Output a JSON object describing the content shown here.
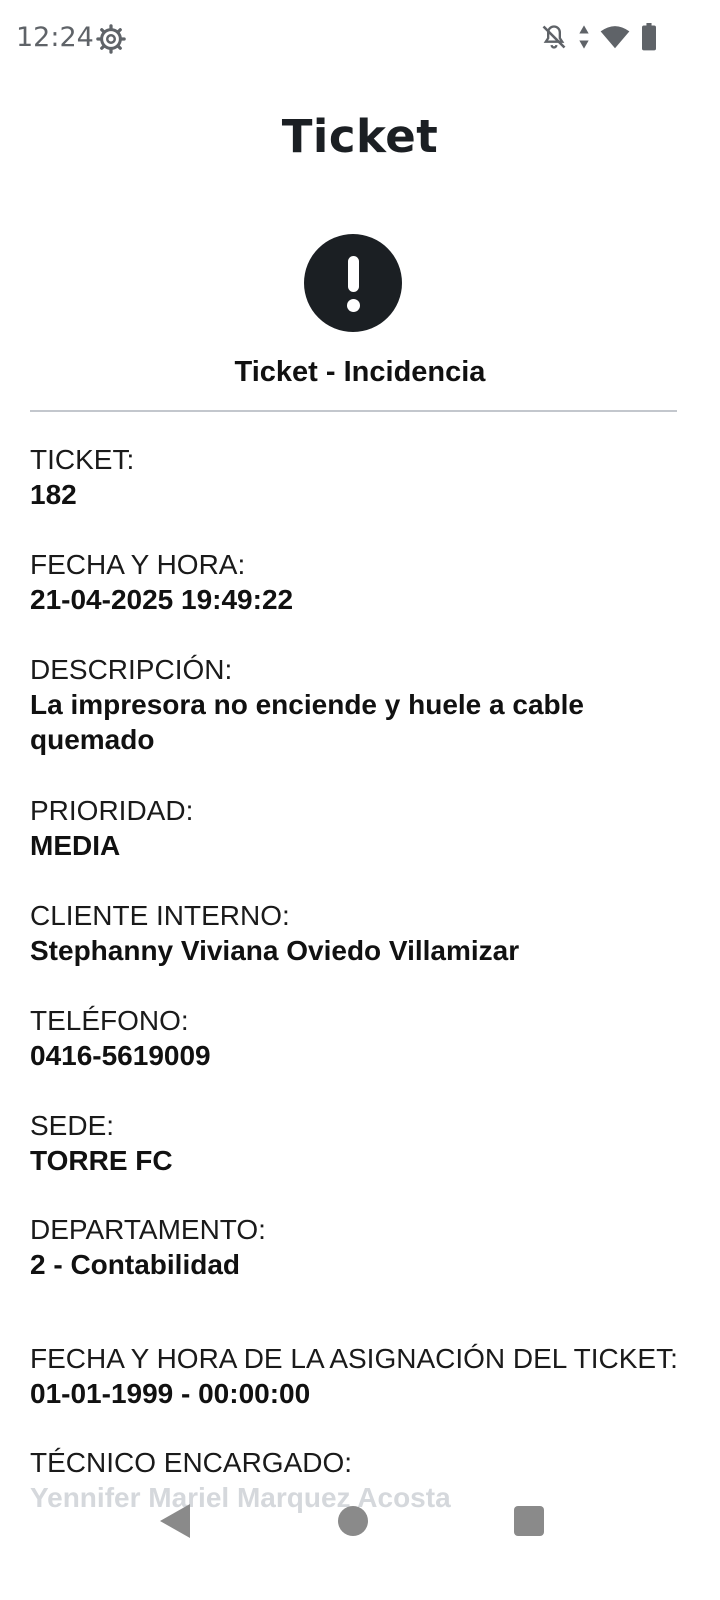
{
  "status_bar": {
    "time": "12:24",
    "icons": [
      "settings-gear-icon",
      "notifications-off-icon",
      "data-arrows-icon",
      "wifi-icon",
      "battery-icon"
    ]
  },
  "page": {
    "title": "Ticket",
    "alert_icon": "exclamation-circle-icon",
    "subtitle": "Ticket - Incidencia"
  },
  "fields": {
    "ticket": {
      "label": "TICKET:",
      "value": "182"
    },
    "datetime": {
      "label": "FECHA Y HORA:",
      "value": "21-04-2025 19:49:22"
    },
    "description": {
      "label": "DESCRIPCIÓN:",
      "value_line1": "La impresora no enciende y huele a cable",
      "value_line2": "quemado"
    },
    "priority": {
      "label": "PRIORIDAD:",
      "value": "MEDIA"
    },
    "client": {
      "label": "CLIENTE INTERNO:",
      "value": "Stephanny Viviana Oviedo Villamizar"
    },
    "phone": {
      "label": "TELÉFONO:",
      "value": "0416-5619009"
    },
    "site": {
      "label": "SEDE:",
      "value": "TORRE FC"
    },
    "department": {
      "label": "DEPARTAMENTO:",
      "value": "2 - Contabilidad"
    },
    "assignment": {
      "label": "FECHA Y HORA DE LA ASIGNACIÓN DEL TICKET:",
      "value": "01-01-1999 - 00:00:00"
    },
    "technician": {
      "label": "TÉCNICO ENCARGADO:",
      "value": "Yennifer Mariel Marquez Acosta"
    }
  },
  "nav": {
    "back": "back-triangle-icon",
    "home": "home-circle-icon",
    "recents": "recents-square-icon"
  }
}
